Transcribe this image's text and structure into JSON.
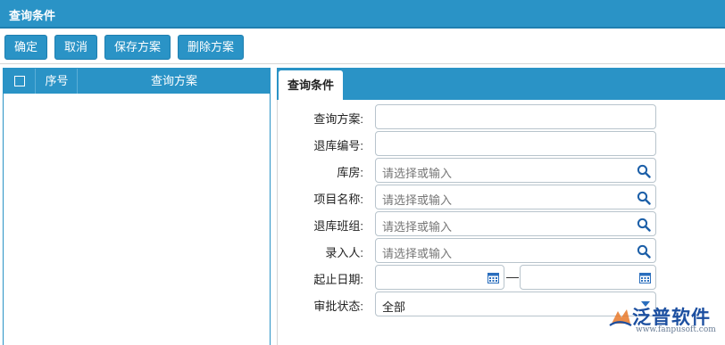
{
  "window": {
    "title": "查询条件"
  },
  "toolbar": {
    "confirm": "确定",
    "cancel": "取消",
    "save_plan": "保存方案",
    "delete_plan": "删除方案"
  },
  "plan_list": {
    "columns": {
      "seq": "序号",
      "plan": "查询方案"
    }
  },
  "tabs": {
    "active": "查询条件"
  },
  "form": {
    "fields": [
      {
        "label": "查询方案:",
        "value": "",
        "placeholder": ""
      },
      {
        "label": "退库编号:",
        "value": "",
        "placeholder": ""
      },
      {
        "label": "库房:",
        "placeholder": "请选择或输入"
      },
      {
        "label": "项目名称:",
        "placeholder": "请选择或输入"
      },
      {
        "label": "退库班组:",
        "placeholder": "请选择或输入"
      },
      {
        "label": "录入人:",
        "placeholder": "请选择或输入"
      },
      {
        "label": "起止日期:",
        "separator": "—"
      },
      {
        "label": "审批状态:",
        "value": "全部"
      }
    ]
  },
  "logo": {
    "text": "泛普软件",
    "url": "www.fanpusoft.com"
  },
  "colors": {
    "accent": "#2a93c6",
    "accent_dark": "#1f7fb0",
    "logo": "#1c4fa0"
  },
  "icons": [
    "search-icon",
    "calendar-icon",
    "chevron-down-icon",
    "checkbox-icon",
    "logo-icon"
  ]
}
